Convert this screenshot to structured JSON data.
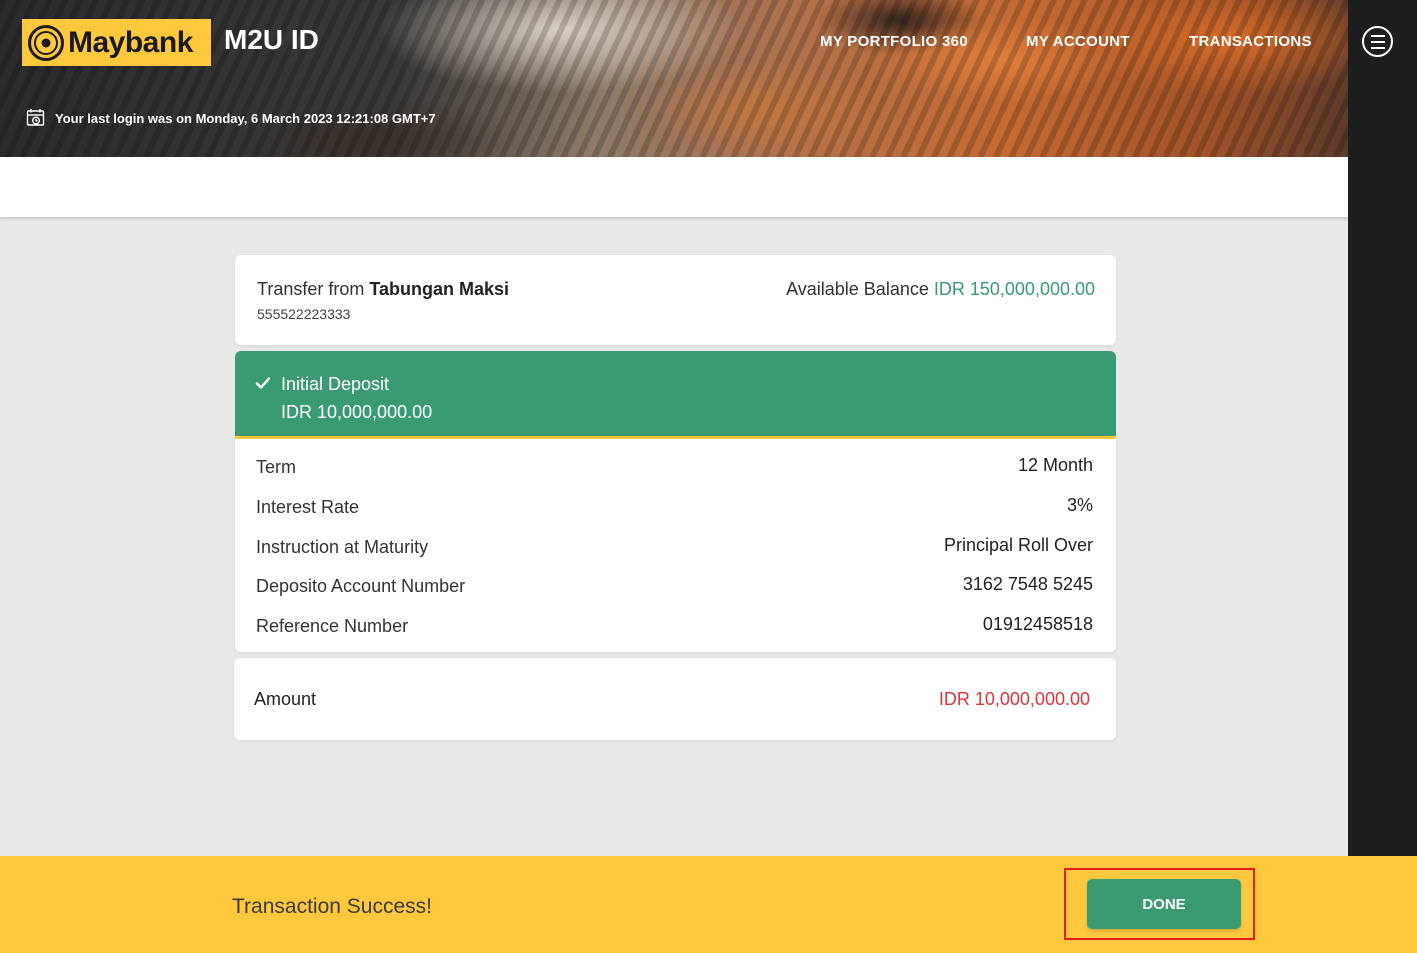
{
  "header": {
    "logo_text": "Maybank",
    "app_title": "M2U ID",
    "nav": [
      "MY PORTFOLIO 360",
      "MY ACCOUNT",
      "TRANSACTIONS"
    ],
    "last_login": "Your last login was on Monday, 6 March 2023 12:21:08 GMT+7"
  },
  "source": {
    "from_prefix": "Transfer from",
    "account_name": "Tabungan Maksi",
    "account_number": "555522223333",
    "balance_label": "Available Balance",
    "balance_value": "IDR 150,000,000.00"
  },
  "status": {
    "label": "Initial Deposit",
    "amount": "IDR 10,000,000.00"
  },
  "details": [
    {
      "label": "Term",
      "value": "12 Month"
    },
    {
      "label": "Interest Rate",
      "value": "3%"
    },
    {
      "label": "Instruction at Maturity",
      "value": "Principal Roll Over"
    },
    {
      "label": "Deposito Account Number",
      "value": "3162 7548 5245"
    },
    {
      "label": "Reference Number",
      "value": "01912458518"
    }
  ],
  "amount": {
    "label": "Amount",
    "value": "IDR 10,000,000.00"
  },
  "footer": {
    "message": "Transaction Success!",
    "done_label": "DONE"
  },
  "colors": {
    "brand_yellow": "#ffc83d",
    "accent_green": "#3a9b73",
    "amount_red": "#e0343d"
  },
  "icons": [
    "maybank-logo-icon",
    "calendar-clock-icon",
    "hamburger-menu-icon",
    "checkmark-icon"
  ]
}
